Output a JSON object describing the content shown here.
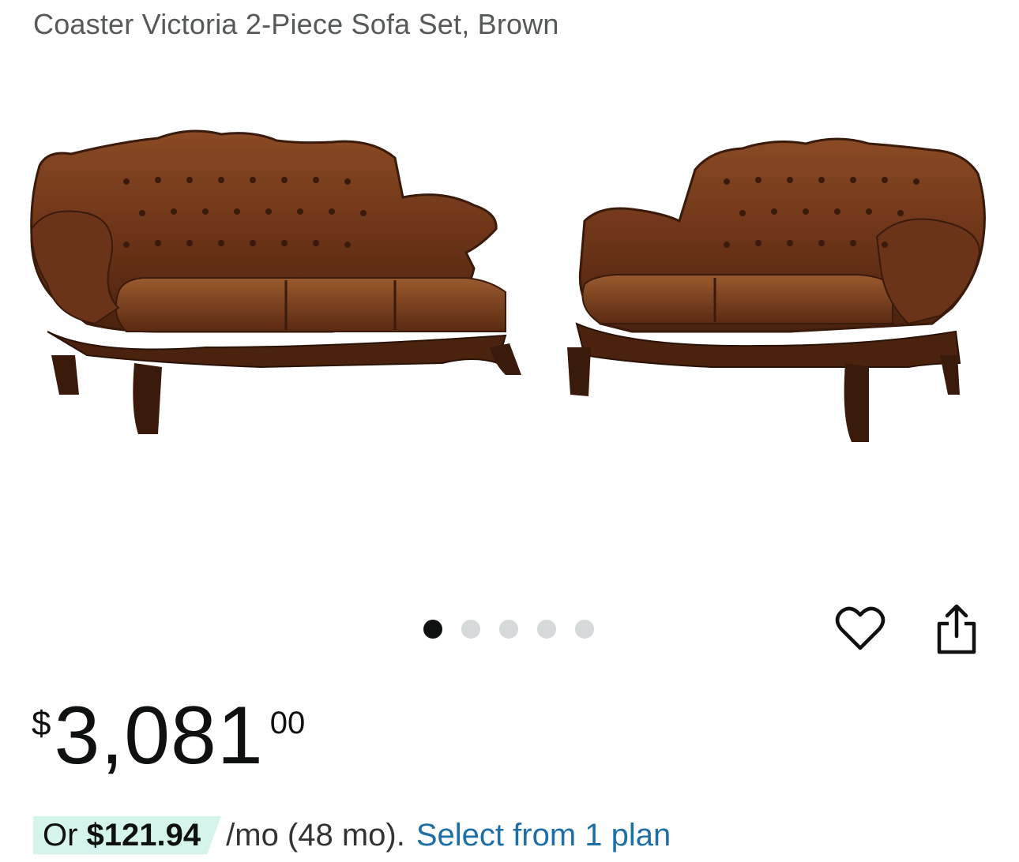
{
  "product": {
    "title": "Coaster Victoria 2-Piece Sofa Set, Brown",
    "image_alt": "Brown tufted leather sofa and loveseat with carved wood trim"
  },
  "carousel": {
    "total": 5,
    "active_index": 0
  },
  "actions": {
    "wishlist_icon": "heart-icon",
    "share_icon": "share-icon"
  },
  "price": {
    "symbol": "$",
    "whole": "3,081",
    "fraction": "00"
  },
  "financing": {
    "prefix": "Or ",
    "monthly": "$121.94",
    "terms": "/mo (48 mo).",
    "link_label": "Select from 1 plan",
    "chip_color": "#d4f4ec",
    "link_color": "#1d6fa5"
  }
}
